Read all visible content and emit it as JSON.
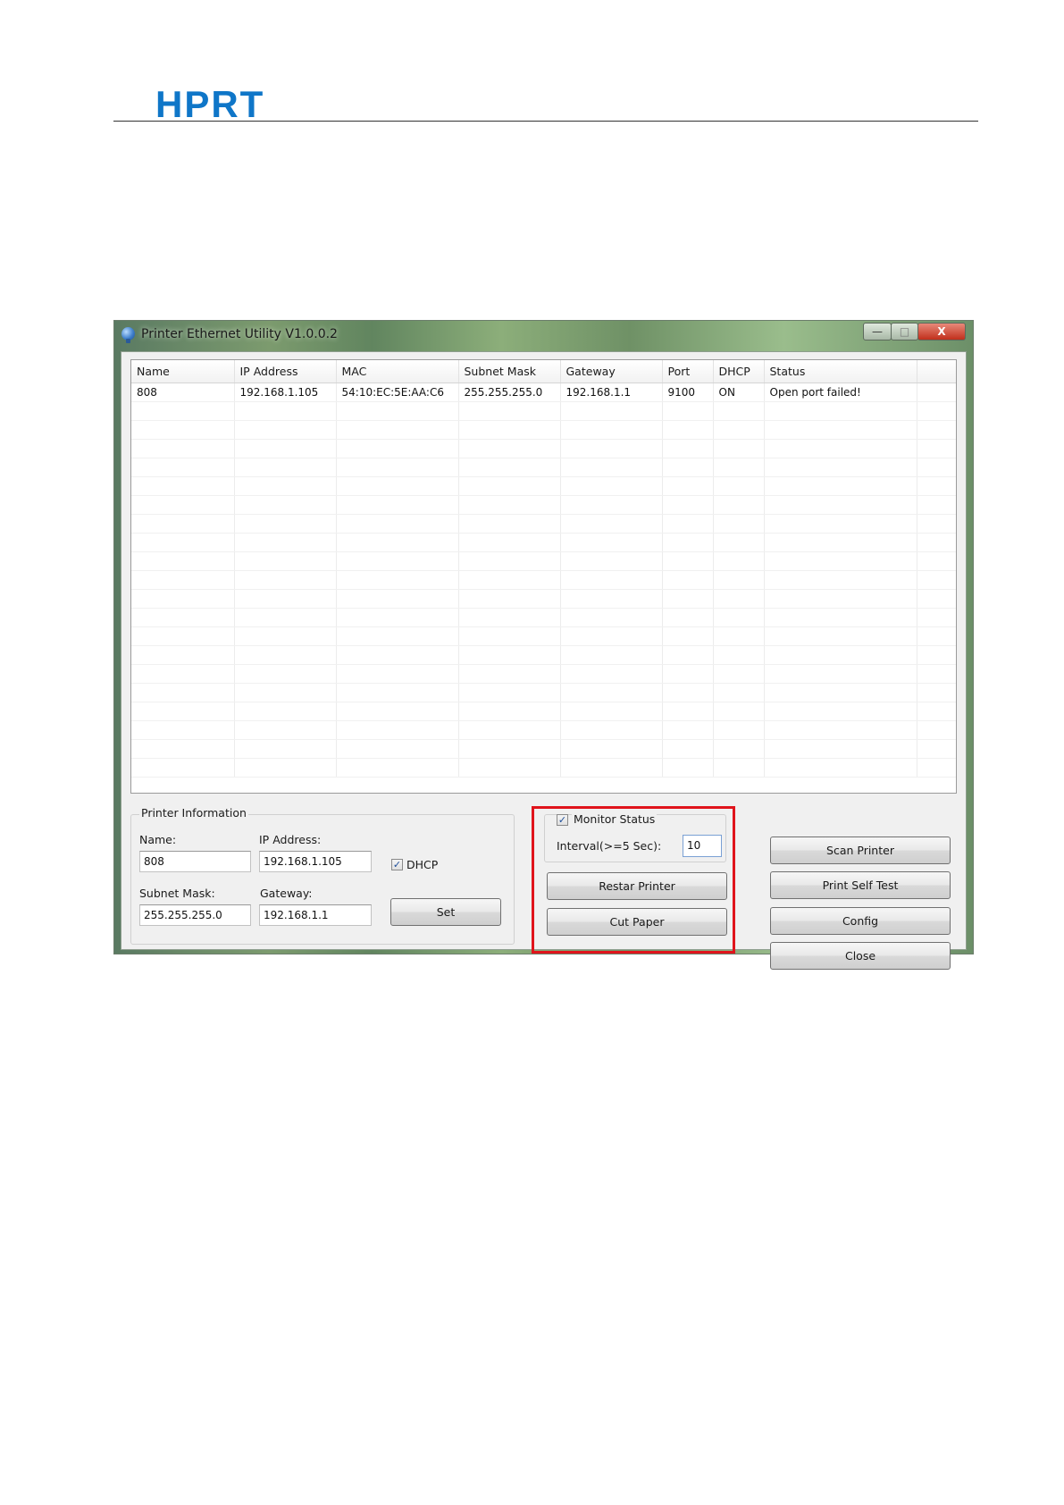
{
  "document": {
    "logo_text": "HPRT",
    "brand_color": "#0f76c8"
  },
  "window": {
    "title": "Printer Ethernet Utility  V1.0.0.2",
    "controls": {
      "minimize": "—",
      "maximize": "□",
      "close": "X"
    }
  },
  "printer_list": {
    "columns": [
      "Name",
      "IP Address",
      "MAC",
      "Subnet Mask",
      "Gateway",
      "Port",
      "DHCP",
      "Status"
    ],
    "rows": [
      [
        "808",
        "192.168.1.105",
        "54:10:EC:5E:AA:C6",
        "255.255.255.0",
        "192.168.1.1",
        "9100",
        "ON",
        "Open port failed!"
      ]
    ]
  },
  "printer_info": {
    "group_title": "Printer Information",
    "name_label": "Name:",
    "name_value": "808",
    "ip_label": "IP Address:",
    "ip_value": "192.168.1.105",
    "dhcp_label": "DHCP",
    "dhcp_checked": true,
    "subnet_label": "Subnet Mask:",
    "subnet_value": "255.255.255.0",
    "gateway_label": "Gateway:",
    "gateway_value": "192.168.1.1",
    "set_button": "Set"
  },
  "monitor": {
    "checkbox_label": "Monitor Status",
    "checked": true,
    "interval_label": "Interval(>=5 Sec):",
    "interval_value": "10",
    "restart_button": "Restar Printer",
    "cut_button": "Cut Paper",
    "highlight_color": "#e0141c"
  },
  "actions": {
    "scan": "Scan Printer",
    "self_test": "Print Self Test",
    "config": "Config",
    "close": "Close"
  }
}
